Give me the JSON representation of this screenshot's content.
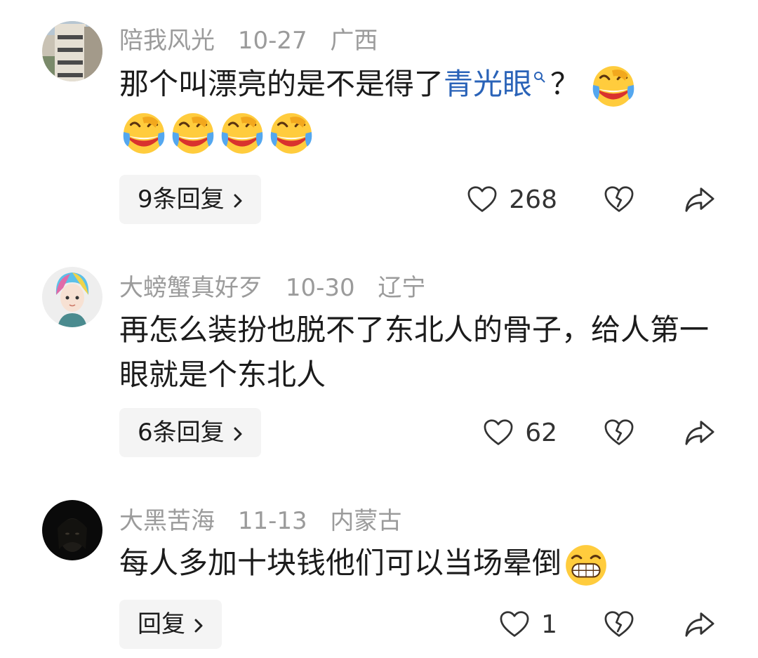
{
  "comments": [
    {
      "username": "陪我风光",
      "date": "10-27",
      "location": "广西",
      "text_before": "那个叫漂亮的是不是得了",
      "link_text": "青光眼",
      "text_after": "？",
      "reply_label": "9条回复",
      "likes": "268",
      "emoji_icon": "laughing-tears-emoji-icon"
    },
    {
      "username": "大螃蟹真好歹",
      "date": "10-30",
      "location": "辽宁",
      "text": "再怎么装扮也脱不了东北人的骨子，给人第一眼就是个东北人",
      "reply_label": "6条回复",
      "likes": "62"
    },
    {
      "username": "大黑苦海",
      "date": "11-13",
      "location": "内蒙古",
      "text": "每人多加十块钱他们可以当场晕倒",
      "reply_label": "回复",
      "likes": "1",
      "emoji_icon": "grinning-emoji-icon"
    }
  ],
  "colors": {
    "link": "#2a63b8",
    "meta": "#9b9b9b",
    "reply_bg": "#f4f4f4"
  }
}
